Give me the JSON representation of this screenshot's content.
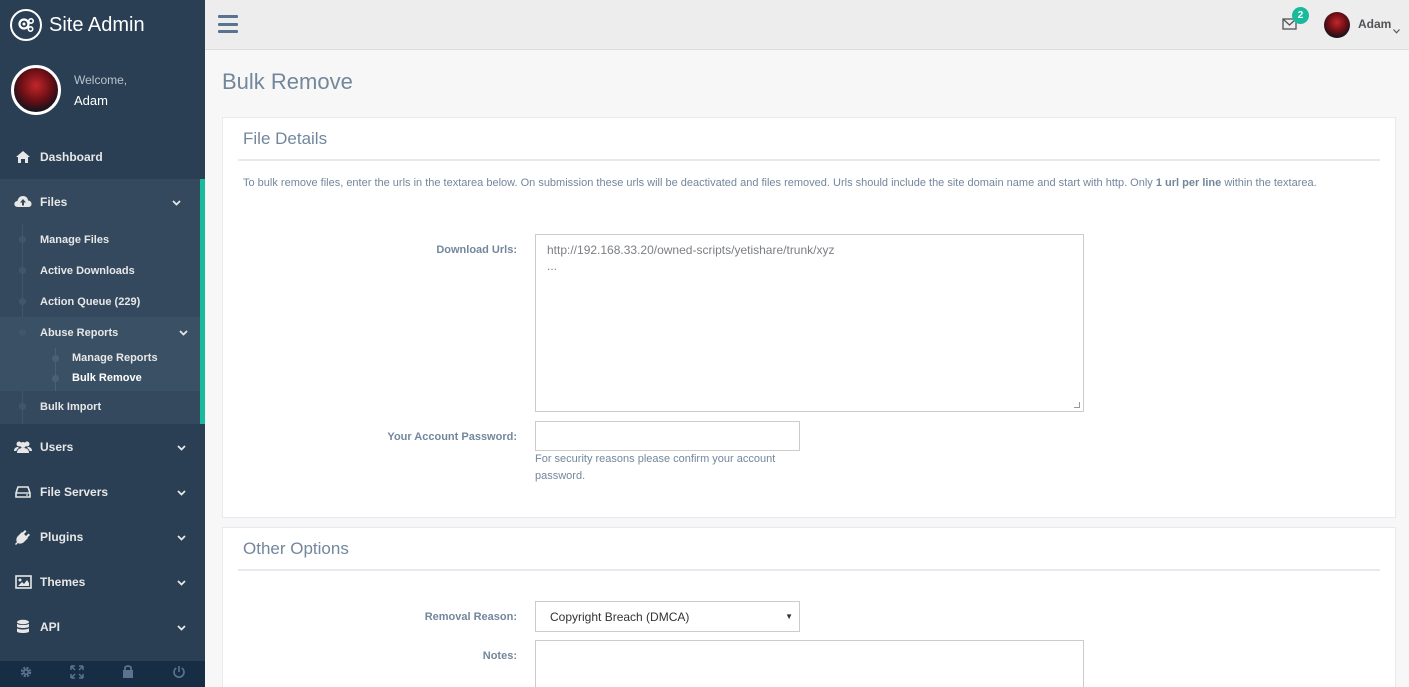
{
  "app": {
    "title": "Site Admin"
  },
  "profile": {
    "welcome": "Welcome,",
    "name": "Adam"
  },
  "sidebar": {
    "items": [
      {
        "label": "Dashboard",
        "icon": "home-icon"
      },
      {
        "label": "Files",
        "icon": "cloud-upload-icon"
      },
      {
        "label": "Users",
        "icon": "users-icon"
      },
      {
        "label": "File Servers",
        "icon": "hdd-icon"
      },
      {
        "label": "Plugins",
        "icon": "plug-icon"
      },
      {
        "label": "Themes",
        "icon": "image-icon"
      },
      {
        "label": "API",
        "icon": "database-icon"
      }
    ],
    "files_submenu": [
      {
        "label": "Manage Files"
      },
      {
        "label": "Active Downloads"
      },
      {
        "label": "Action Queue (229)"
      },
      {
        "label": "Abuse Reports"
      },
      {
        "label": "Bulk Import"
      }
    ],
    "abuse_submenu": [
      {
        "label": "Manage Reports"
      },
      {
        "label": "Bulk Remove"
      }
    ],
    "footer_icons": [
      "gear-icon",
      "fullscreen-icon",
      "lock-icon",
      "power-icon"
    ]
  },
  "topbar": {
    "notification_count": "2",
    "user_name": "Adam"
  },
  "page": {
    "title": "Bulk Remove"
  },
  "file_details": {
    "title": "File Details",
    "intro_pre": "To bulk remove files, enter the urls in the textarea below. On submission these urls will be deactivated and files removed. Urls should include the site domain name and start with http. Only ",
    "intro_bold": "1 url per line",
    "intro_post": " within the textarea.",
    "download_urls_label": "Download Urls:",
    "download_urls_placeholder": "http://192.168.33.20/owned-scripts/yetishare/trunk/xyz\n...",
    "password_label": "Your Account Password:",
    "password_value": "",
    "password_help": "For security reasons please confirm your account password."
  },
  "other_options": {
    "title": "Other Options",
    "removal_reason_label": "Removal Reason:",
    "removal_reason_value": "Copyright Breach (DMCA)",
    "notes_label": "Notes:",
    "notes_value": ""
  }
}
